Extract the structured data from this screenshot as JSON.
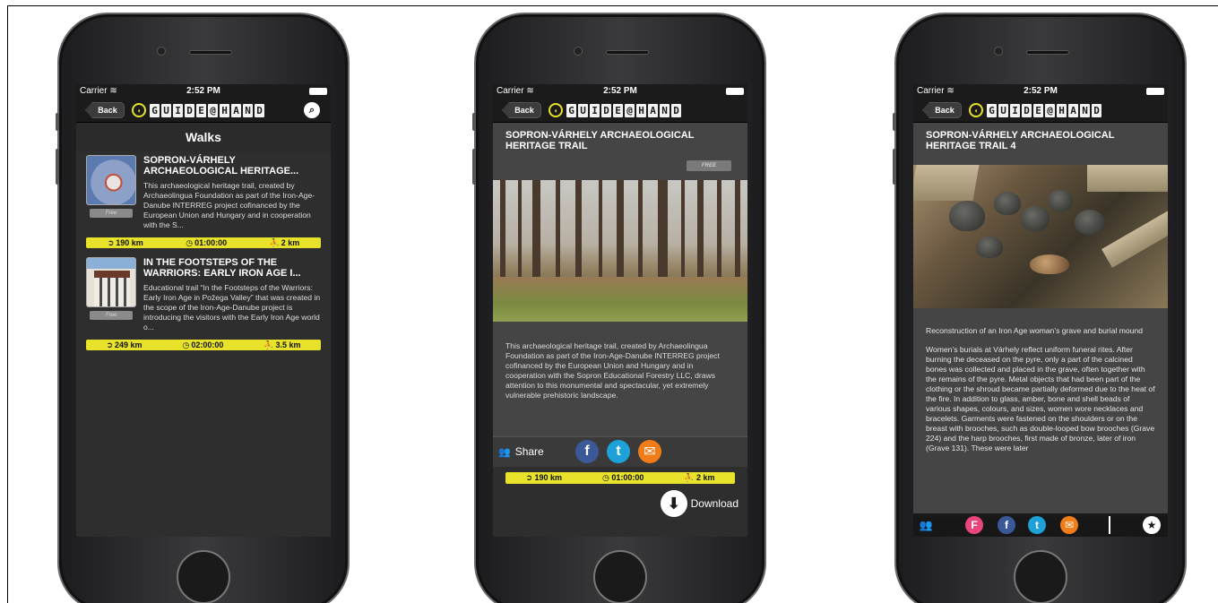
{
  "status": {
    "carrier": "Carrier",
    "time": "2:52 PM"
  },
  "nav": {
    "back": "Back",
    "logo_letters": [
      "G",
      "U",
      "I",
      "D",
      "E",
      "@",
      "H",
      "A",
      "N",
      "D"
    ]
  },
  "icons": {
    "wifi": "wifi-icon",
    "battery": "battery-icon",
    "search": "search-icon",
    "logo": "speaker-logo-icon",
    "distance": "distance-icon",
    "clock": "clock-icon",
    "walker": "walker-icon",
    "share": "people-icon",
    "facebook": "facebook-icon",
    "twitter": "twitter-icon",
    "email": "email-icon",
    "download": "download-arrow-icon",
    "foursquare": "foursquare-icon",
    "star": "star-icon"
  },
  "colors": {
    "accent_yellow": "#e8e32a",
    "panel": "#454545",
    "nav_bg": "#1b1b1b"
  },
  "screen1": {
    "title": "Walks",
    "items": [
      {
        "title": "SOPRON-VÁRHELY ARCHAEOLOGICAL HERITAGE...",
        "badge": "Free",
        "desc": "This archaeological heritage trail, created by Archaeolingua Foundation as part of the Iron-Age-Danube INTERREG project cofinanced by the European Union and Hungary and in cooperation with the S...",
        "distance": "190 km",
        "duration": "01:00:00",
        "walk": "2 km"
      },
      {
        "title": "IN THE FOOTSTEPS OF THE WARRIORS: EARLY IRON AGE I...",
        "badge": "Free",
        "desc": "Educational trail “In the Footsteps of the Warriors: Early Iron Age in Požega Valley” that was created in the scope of the Iron-Age-Danube project is introducing the visitors with the Early Iron Age world o...",
        "distance": "249 km",
        "duration": "02:00:00",
        "walk": "3.5 km"
      }
    ]
  },
  "screen2": {
    "title": "SOPRON-VÁRHELY ARCHAEOLOGICAL HERITAGE TRAIL",
    "badge": "Free",
    "desc": "This archaeological heritage trail, created by Archaeolingua Foundation as part of the Iron-Age-Danube INTERREG project cofinanced by the European Union and Hungary and in cooperation with the Sopron Educational Forestry LLC, draws attention to this monumental and spectacular, yet extremely vulnerable prehistoric landscape.",
    "share_label": "Share",
    "distance": "190 km",
    "duration": "01:00:00",
    "walk": "2 km",
    "download_label": "Download"
  },
  "screen3": {
    "title": "SOPRON-VÁRHELY ARCHAEOLOGICAL HERITAGE TRAIL 4",
    "caption": "Reconstruction of an Iron Age woman’s grave and burial mound",
    "body": "Women’s burials at Várhely reflect uniform funeral rites. After burning the deceased on the pyre, only a part of the calcined bones was collected and placed in the grave, often together with the remains of the pyre. Metal objects that had been part of the clothing or the shroud became partially deformed due to the heat of the fire. In addition to glass, amber, bone and shell beads of various shapes, colours, and sizes, women wore necklaces and bracelets. Garments were fastened on the shoulders or on the breast with brooches, such as double-looped bow brooches (Grave 224) and the harp brooches, first made of bronze, later of iron (Grave 131). These were later"
  }
}
